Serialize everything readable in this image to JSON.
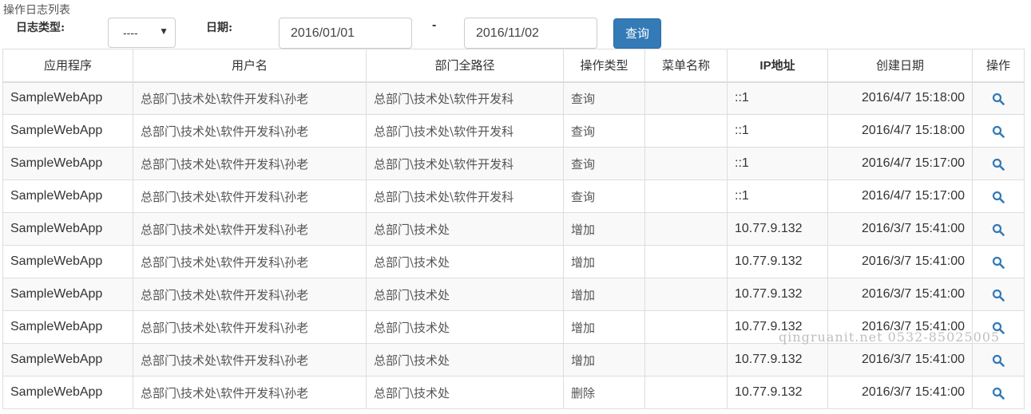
{
  "page": {
    "title": "操作日志列表"
  },
  "filters": {
    "type_label": "日志类型:",
    "type_value": "----",
    "date_label": "日期:",
    "date_from": "2016/01/01",
    "date_separator": "-",
    "date_to": "2016/11/02",
    "query_label": "查询"
  },
  "table": {
    "headers": [
      "应用程序",
      "用户名",
      "部门全路径",
      "操作类型",
      "菜单名称",
      "IP地址",
      "创建日期",
      "操作"
    ],
    "rows": [
      {
        "app": "SampleWebApp",
        "user": "总部门\\技术处\\软件开发科\\孙老",
        "dept": "总部门\\技术处\\软件开发科",
        "op": "查询",
        "menu": "",
        "ip": "::1",
        "date": "2016/4/7 15:18:00"
      },
      {
        "app": "SampleWebApp",
        "user": "总部门\\技术处\\软件开发科\\孙老",
        "dept": "总部门\\技术处\\软件开发科",
        "op": "查询",
        "menu": "",
        "ip": "::1",
        "date": "2016/4/7 15:18:00"
      },
      {
        "app": "SampleWebApp",
        "user": "总部门\\技术处\\软件开发科\\孙老",
        "dept": "总部门\\技术处\\软件开发科",
        "op": "查询",
        "menu": "",
        "ip": "::1",
        "date": "2016/4/7 15:17:00"
      },
      {
        "app": "SampleWebApp",
        "user": "总部门\\技术处\\软件开发科\\孙老",
        "dept": "总部门\\技术处\\软件开发科",
        "op": "查询",
        "menu": "",
        "ip": "::1",
        "date": "2016/4/7 15:17:00"
      },
      {
        "app": "SampleWebApp",
        "user": "总部门\\技术处\\软件开发科\\孙老",
        "dept": "总部门\\技术处",
        "op": "增加",
        "menu": "",
        "ip": "10.77.9.132",
        "date": "2016/3/7 15:41:00"
      },
      {
        "app": "SampleWebApp",
        "user": "总部门\\技术处\\软件开发科\\孙老",
        "dept": "总部门\\技术处",
        "op": "增加",
        "menu": "",
        "ip": "10.77.9.132",
        "date": "2016/3/7 15:41:00"
      },
      {
        "app": "SampleWebApp",
        "user": "总部门\\技术处\\软件开发科\\孙老",
        "dept": "总部门\\技术处",
        "op": "增加",
        "menu": "",
        "ip": "10.77.9.132",
        "date": "2016/3/7 15:41:00"
      },
      {
        "app": "SampleWebApp",
        "user": "总部门\\技术处\\软件开发科\\孙老",
        "dept": "总部门\\技术处",
        "op": "增加",
        "menu": "",
        "ip": "10.77.9.132",
        "date": "2016/3/7 15:41:00"
      },
      {
        "app": "SampleWebApp",
        "user": "总部门\\技术处\\软件开发科\\孙老",
        "dept": "总部门\\技术处",
        "op": "增加",
        "menu": "",
        "ip": "10.77.9.132",
        "date": "2016/3/7 15:41:00"
      },
      {
        "app": "SampleWebApp",
        "user": "总部门\\技术处\\软件开发科\\孙老",
        "dept": "总部门\\技术处",
        "op": "删除",
        "menu": "",
        "ip": "10.77.9.132",
        "date": "2016/3/7 15:41:00"
      }
    ],
    "action_icon": "search-icon"
  },
  "colors": {
    "primary": "#337ab7",
    "border": "#dddddd",
    "stripe": "#f9f9f9"
  },
  "watermark": "qingruanit.net 0532-85025005"
}
